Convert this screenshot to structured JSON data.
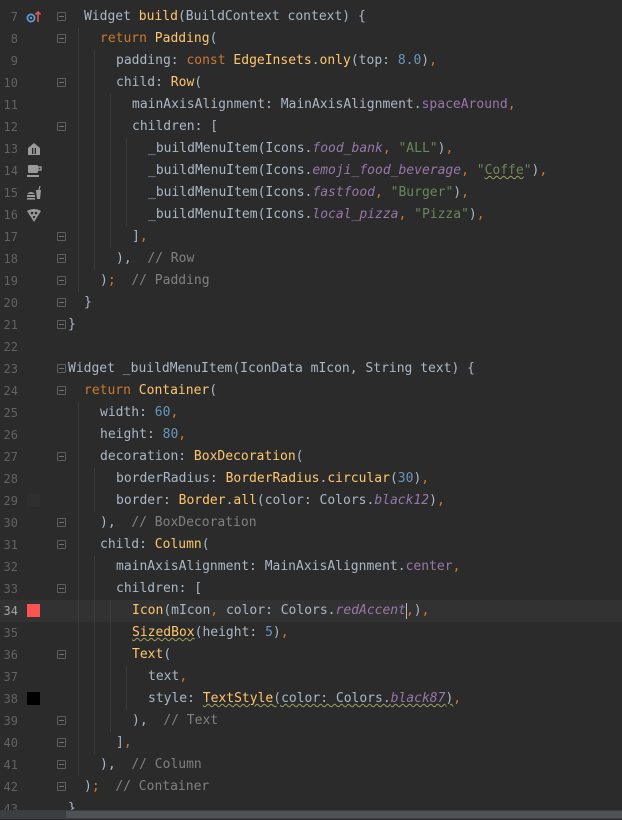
{
  "editor": {
    "language": "dart",
    "current_line": 34,
    "lines": [
      {
        "n": "7",
        "segs": [
          [
            "kw",
            ""
          ],
          [
            "plain",
            "Widget "
          ],
          [
            "fn",
            "build"
          ],
          [
            "plain",
            "(BuildContext context) {"
          ]
        ],
        "gutter": "override-up-icon"
      },
      {
        "n": "8",
        "segs": [
          [
            "kw",
            "return "
          ],
          [
            "fn",
            "Padding"
          ],
          [
            "plain",
            "("
          ]
        ]
      },
      {
        "n": "9",
        "segs": [
          [
            "plain",
            "padding: "
          ],
          [
            "kw",
            "const "
          ],
          [
            "fn",
            "EdgeInsets"
          ],
          [
            "plain",
            "."
          ],
          [
            "fn",
            "only"
          ],
          [
            "plain",
            "(top: "
          ],
          [
            "num",
            "8.0"
          ],
          [
            "plain",
            ")"
          ],
          [
            "kw",
            ","
          ]
        ]
      },
      {
        "n": "10",
        "segs": [
          [
            "plain",
            "child: "
          ],
          [
            "fn",
            "Row"
          ],
          [
            "plain",
            "("
          ]
        ]
      },
      {
        "n": "11",
        "segs": [
          [
            "plain",
            "mainAxisAlignment: MainAxisAlignment."
          ],
          [
            "fld",
            "spaceAround"
          ],
          [
            "kw",
            ","
          ]
        ]
      },
      {
        "n": "12",
        "segs": [
          [
            "plain",
            "children: ["
          ]
        ]
      },
      {
        "n": "13",
        "segs": [
          [
            "plain",
            "_buildMenuItem(Icons."
          ],
          [
            "it",
            "food_bank"
          ],
          [
            "kw",
            ", "
          ],
          [
            "str",
            "\"ALL\""
          ],
          [
            "plain",
            ")"
          ],
          [
            "kw",
            ","
          ]
        ],
        "gutter": "food-bank-icon"
      },
      {
        "n": "14",
        "segs": [
          [
            "plain",
            "_buildMenuItem(Icons."
          ],
          [
            "it",
            "emoji_food_beverage"
          ],
          [
            "kw",
            ", "
          ],
          [
            "str",
            "\""
          ],
          [
            "strw",
            "Coffe"
          ],
          [
            "str",
            "\""
          ],
          [
            "plain",
            ")"
          ],
          [
            "kw",
            ","
          ]
        ],
        "gutter": "food-beverage-icon"
      },
      {
        "n": "15",
        "segs": [
          [
            "plain",
            "_buildMenuItem(Icons."
          ],
          [
            "it",
            "fastfood"
          ],
          [
            "kw",
            ", "
          ],
          [
            "str",
            "\"Burger\""
          ],
          [
            "plain",
            ")"
          ],
          [
            "kw",
            ","
          ]
        ],
        "gutter": "fastfood-icon"
      },
      {
        "n": "16",
        "segs": [
          [
            "plain",
            "_buildMenuItem(Icons."
          ],
          [
            "it",
            "local_pizza"
          ],
          [
            "kw",
            ", "
          ],
          [
            "str",
            "\"Pizza\""
          ],
          [
            "plain",
            ")"
          ],
          [
            "kw",
            ","
          ]
        ],
        "gutter": "local-pizza-icon"
      },
      {
        "n": "17",
        "segs": [
          [
            "plain",
            "]"
          ],
          [
            "kw",
            ","
          ]
        ]
      },
      {
        "n": "18",
        "segs": [
          [
            "plain",
            "),  "
          ],
          [
            "cm",
            "// Row"
          ]
        ]
      },
      {
        "n": "19",
        "segs": [
          [
            "plain",
            ")"
          ],
          [
            "kw",
            ";"
          ],
          [
            "plain",
            "  "
          ],
          [
            "cm",
            "// Padding"
          ]
        ]
      },
      {
        "n": "20",
        "segs": [
          [
            "plain",
            "}"
          ]
        ]
      },
      {
        "n": "21",
        "segs": [
          [
            "plain",
            "}"
          ]
        ]
      },
      {
        "n": "22",
        "segs": []
      },
      {
        "n": "23",
        "segs": [
          [
            "plain",
            "Widget _buildMenuItem(IconData mIcon, String text) {"
          ]
        ]
      },
      {
        "n": "24",
        "segs": [
          [
            "kw",
            "return "
          ],
          [
            "fn",
            "Container"
          ],
          [
            "plain",
            "("
          ]
        ]
      },
      {
        "n": "25",
        "segs": [
          [
            "plain",
            "width: "
          ],
          [
            "num",
            "60"
          ],
          [
            "kw",
            ","
          ]
        ]
      },
      {
        "n": "26",
        "segs": [
          [
            "plain",
            "height: "
          ],
          [
            "num",
            "80"
          ],
          [
            "kw",
            ","
          ]
        ]
      },
      {
        "n": "27",
        "segs": [
          [
            "plain",
            "decoration: "
          ],
          [
            "fn",
            "BoxDecoration"
          ],
          [
            "plain",
            "("
          ]
        ]
      },
      {
        "n": "28",
        "segs": [
          [
            "plain",
            "borderRadius: "
          ],
          [
            "fn",
            "BorderRadius"
          ],
          [
            "plain",
            "."
          ],
          [
            "fn",
            "circular"
          ],
          [
            "plain",
            "("
          ],
          [
            "num",
            "30"
          ],
          [
            "plain",
            ")"
          ],
          [
            "kw",
            ","
          ]
        ]
      },
      {
        "n": "29",
        "segs": [
          [
            "plain",
            "border: "
          ],
          [
            "fn",
            "Border"
          ],
          [
            "plain",
            "."
          ],
          [
            "fn",
            "all"
          ],
          [
            "plain",
            "(color: Colors."
          ],
          [
            "it",
            "black12"
          ],
          [
            "plain",
            ")"
          ],
          [
            "kw",
            ","
          ]
        ],
        "gutter": "color-swatch-black12"
      },
      {
        "n": "30",
        "segs": [
          [
            "plain",
            "),  "
          ],
          [
            "cm",
            "// BoxDecoration"
          ]
        ]
      },
      {
        "n": "31",
        "segs": [
          [
            "plain",
            "child: "
          ],
          [
            "fn",
            "Column"
          ],
          [
            "plain",
            "("
          ]
        ]
      },
      {
        "n": "32",
        "segs": [
          [
            "plain",
            "mainAxisAlignment: MainAxisAlignment."
          ],
          [
            "fld",
            "center"
          ],
          [
            "kw",
            ","
          ]
        ]
      },
      {
        "n": "33",
        "segs": [
          [
            "plain",
            "children: ["
          ]
        ]
      },
      {
        "n": "34",
        "segs": [
          [
            "fn",
            "Icon"
          ],
          [
            "plain",
            "(mIcon"
          ],
          [
            "kw",
            ", "
          ],
          [
            "plain",
            "color: Colors."
          ],
          [
            "it",
            "redAccent"
          ],
          [
            "caret",
            ""
          ],
          [
            "kw",
            ","
          ],
          [
            "plain",
            ")"
          ],
          [
            "kw",
            ","
          ]
        ],
        "gutter": "color-swatch-redaccent"
      },
      {
        "n": "35",
        "segs": [
          [
            "fnw",
            "SizedBox"
          ],
          [
            "plain",
            "(height: "
          ],
          [
            "num",
            "5"
          ],
          [
            "plain",
            ")"
          ],
          [
            "kw",
            ","
          ]
        ]
      },
      {
        "n": "36",
        "segs": [
          [
            "fn",
            "Text"
          ],
          [
            "plain",
            "("
          ]
        ]
      },
      {
        "n": "37",
        "segs": [
          [
            "plain",
            "text"
          ],
          [
            "kw",
            ","
          ]
        ]
      },
      {
        "n": "38",
        "segs": [
          [
            "plain",
            "style: "
          ],
          [
            "fnw",
            "TextStyle"
          ],
          [
            "plainw",
            "(color: Colors."
          ],
          [
            "itw",
            "black87"
          ],
          [
            "plainw",
            ")"
          ],
          [
            "kw",
            ","
          ]
        ],
        "gutter": "color-swatch-black87"
      },
      {
        "n": "39",
        "segs": [
          [
            "plain",
            "),  "
          ],
          [
            "cm",
            "// Text"
          ]
        ]
      },
      {
        "n": "40",
        "segs": [
          [
            "plain",
            "]"
          ],
          [
            "kw",
            ","
          ]
        ]
      },
      {
        "n": "41",
        "segs": [
          [
            "plain",
            "),  "
          ],
          [
            "cm",
            "// Column"
          ]
        ]
      },
      {
        "n": "42",
        "segs": [
          [
            "plain",
            ")"
          ],
          [
            "kw",
            ";"
          ],
          [
            "plain",
            "  "
          ],
          [
            "cm",
            "// Container"
          ]
        ]
      },
      {
        "n": "43",
        "segs": [
          [
            "plain",
            "}"
          ]
        ]
      }
    ],
    "swatch_colors": {
      "color-swatch-black12": "#2f2f2f",
      "color-swatch-redaccent": "#ff5252",
      "color-swatch-black87": "#000000"
    },
    "colors": {
      "background": "#2b2b2b",
      "current_line": "#323232",
      "keyword": "#cc7832",
      "function": "#ffc66d",
      "number": "#6897bb",
      "string": "#6a8759",
      "comment": "#808080",
      "field": "#9876aa"
    }
  }
}
